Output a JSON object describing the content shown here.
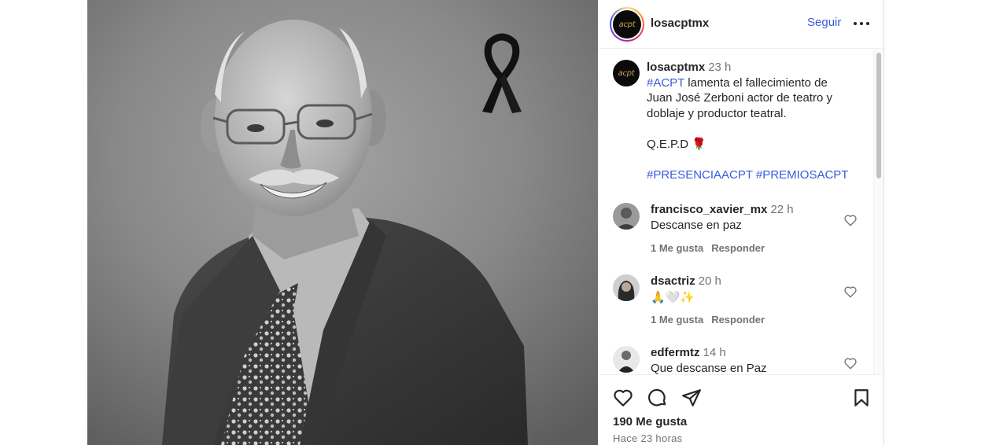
{
  "post": {
    "username": "losacptmx",
    "follow_label": "Seguir",
    "avatar_text": "acpt"
  },
  "caption": {
    "username": "losacptmx",
    "time": "23 h",
    "hashtag_lead": "#ACPT",
    "line1_rest": " lamenta el fallecimiento de",
    "line2": "Juan José Zerboni actor de teatro y",
    "line3": "doblaje y productor teatral.",
    "line4": "Q.E.P.D 🌹",
    "hashtags": "#PRESENCIAACPT #PREMIOSACPT"
  },
  "comments": [
    {
      "username": "francisco_xavier_mx",
      "time": "22 h",
      "text": "Descanse en paz",
      "likes": "1 Me gusta",
      "reply": "Responder"
    },
    {
      "username": "dsactriz",
      "time": "20 h",
      "text": "🙏🤍✨",
      "likes": "1 Me gusta",
      "reply": "Responder"
    },
    {
      "username": "edfermtz",
      "time": "14 h",
      "text": "Que descanse en Paz"
    }
  ],
  "footer": {
    "likes": "190 Me gusta",
    "posted": "Hace 23 horas"
  },
  "icons": [
    "heart-icon",
    "comment-icon",
    "share-icon",
    "bookmark-icon",
    "more-options-icon",
    "mourning-ribbon-icon"
  ],
  "colors": {
    "link": "#3b5bdb",
    "text": "#262626",
    "muted": "#737373"
  }
}
